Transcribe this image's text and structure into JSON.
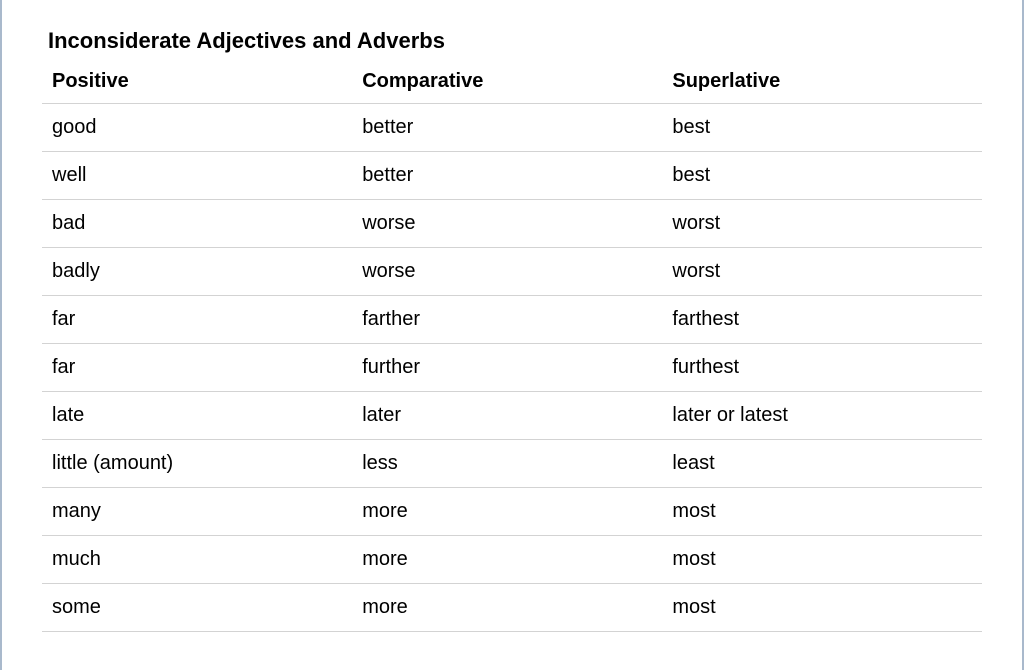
{
  "title": "Inconsiderate Adjectives and Adverbs",
  "headers": {
    "c0": "Positive",
    "c1": "Comparative",
    "c2": "Superlative"
  },
  "rows": [
    {
      "c0": "good",
      "c1": "better",
      "c2": "best"
    },
    {
      "c0": "well",
      "c1": "better",
      "c2": "best"
    },
    {
      "c0": "bad",
      "c1": "worse",
      "c2": "worst"
    },
    {
      "c0": "badly",
      "c1": "worse",
      "c2": "worst"
    },
    {
      "c0": "far",
      "c1": "farther",
      "c2": "farthest"
    },
    {
      "c0": "far",
      "c1": "further",
      "c2": "furthest"
    },
    {
      "c0": "late",
      "c1": "later",
      "c2": "later or latest"
    },
    {
      "c0": "little (amount)",
      "c1": "less",
      "c2": "least"
    },
    {
      "c0": "many",
      "c1": "more",
      "c2": "most"
    },
    {
      "c0": "much",
      "c1": "more",
      "c2": "most"
    },
    {
      "c0": "some",
      "c1": "more",
      "c2": "most"
    }
  ],
  "chart_data": {
    "type": "table",
    "title": "Inconsiderate Adjectives and Adverbs",
    "columns": [
      "Positive",
      "Comparative",
      "Superlative"
    ],
    "rows": [
      [
        "good",
        "better",
        "best"
      ],
      [
        "well",
        "better",
        "best"
      ],
      [
        "bad",
        "worse",
        "worst"
      ],
      [
        "badly",
        "worse",
        "worst"
      ],
      [
        "far",
        "farther",
        "farthest"
      ],
      [
        "far",
        "further",
        "furthest"
      ],
      [
        "late",
        "later",
        "later or latest"
      ],
      [
        "little (amount)",
        "less",
        "least"
      ],
      [
        "many",
        "more",
        "most"
      ],
      [
        "much",
        "more",
        "most"
      ],
      [
        "some",
        "more",
        "most"
      ]
    ]
  }
}
